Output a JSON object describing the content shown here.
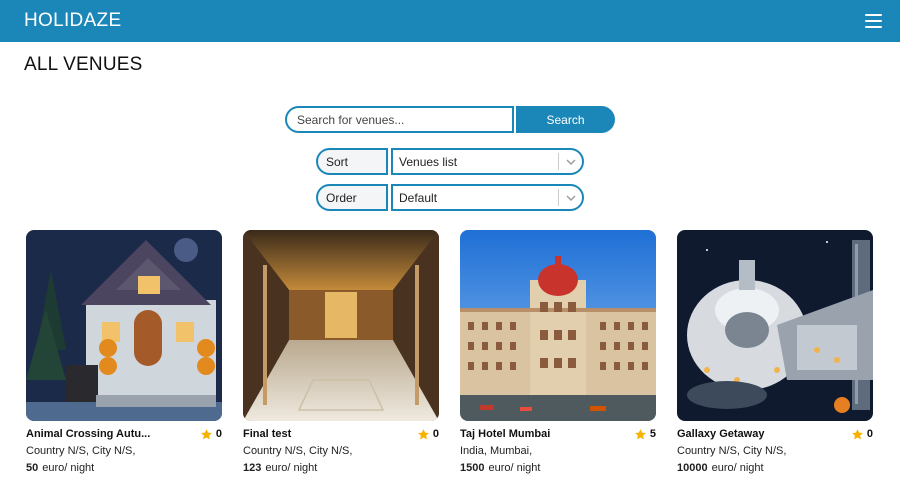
{
  "header": {
    "brand": "HOLIDAZE",
    "menu_icon": "hamburger-menu-icon"
  },
  "page": {
    "title": "ALL VENUES"
  },
  "search": {
    "placeholder": "Search for venues...",
    "button_label": "Search"
  },
  "sort": {
    "label": "Sort",
    "value": "Venues list"
  },
  "order": {
    "label": "Order",
    "value": "Default"
  },
  "colors": {
    "primary": "#1b87b9",
    "star": "#f5b301"
  },
  "venues": [
    {
      "name": "Animal Crossing Autu...",
      "rating": "0",
      "location": "Country N/S, City N/S,",
      "price": "50",
      "price_unit": "euro/ night"
    },
    {
      "name": "Final test",
      "rating": "0",
      "location": "Country N/S, City N/S,",
      "price": "123",
      "price_unit": "euro/ night"
    },
    {
      "name": "Taj Hotel Mumbai",
      "rating": "5",
      "location": "India, Mumbai,",
      "price": "1500",
      "price_unit": "euro/ night"
    },
    {
      "name": "Gallaxy Getaway",
      "rating": "0",
      "location": "Country N/S, City N/S,",
      "price": "10000",
      "price_unit": "euro/ night"
    }
  ]
}
